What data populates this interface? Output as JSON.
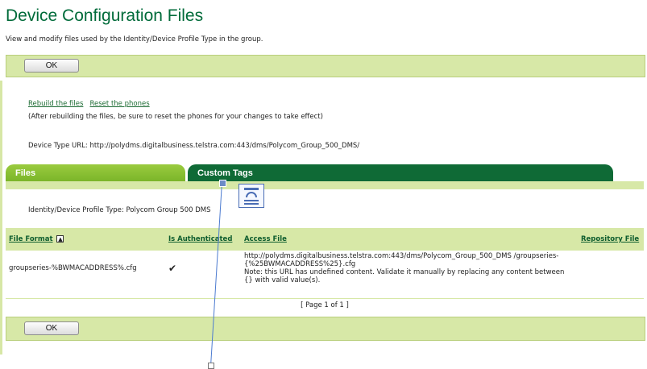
{
  "header": {
    "title": "Device Configuration Files",
    "subtitle": "View and modify files used by the Identity/Device Profile Type in the group."
  },
  "top_bar": {
    "ok_label": "OK"
  },
  "actions": {
    "rebuild_label": "Rebuild the files",
    "reset_label": "Reset the phones",
    "note": "(After rebuilding the files, be sure to reset the phones for your changes to take effect)"
  },
  "device_type_url": {
    "label": "Device Type URL:",
    "value": "http://polydms.digitalbusiness.telstra.com:443/dms/Polycom_Group_500_DMS/"
  },
  "tabs": [
    {
      "label": "Files",
      "active": true
    },
    {
      "label": "Custom Tags",
      "active": false
    }
  ],
  "profile_type": {
    "label": "Identity/Device Profile Type:",
    "value": "Polycom Group 500 DMS"
  },
  "table": {
    "columns": [
      "File Format",
      "Is Authenticated",
      "Access File",
      "Repository File"
    ],
    "rows": [
      {
        "file_format": "groupseries-%BWMACADDRESS%.cfg",
        "is_authenticated": "✔",
        "access_file_url": "http://polydms.digitalbusiness.telstra.com:443/dms/Polycom_Group_500_DMS /groupseries-{%25BWMACADDRESS%25}.cfg",
        "access_file_note": "Note: this URL has undefined content. Validate it manually by replacing any content between {} with valid value(s).",
        "repository_file": ""
      }
    ]
  },
  "pager": "[ Page 1 of 1 ]",
  "bottom_bar": {
    "ok_label": "OK"
  },
  "colors": {
    "brand_green": "#006b3a",
    "bar_green": "#d7e8a7",
    "tab_active": "#8cc232",
    "tab_inactive": "#0f6a36"
  }
}
